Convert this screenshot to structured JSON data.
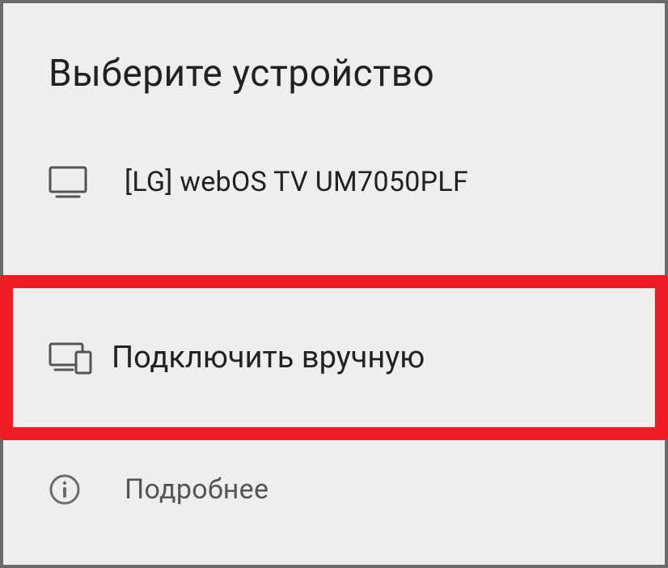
{
  "dialog": {
    "title": "Выберите устройство",
    "device": {
      "icon": "tv-icon",
      "label": "[LG] webOS TV UM7050PLF"
    },
    "manual": {
      "icon": "devices-icon",
      "label": "Подключить вручную",
      "highlighted": true
    },
    "info": {
      "icon": "info-icon",
      "label": "Подробнее"
    }
  }
}
